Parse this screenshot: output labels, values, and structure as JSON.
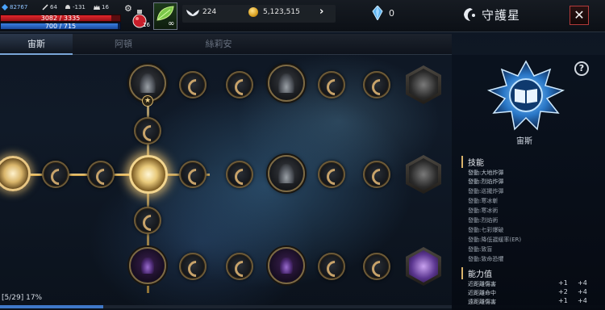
{
  "status": {
    "level_text": "82767",
    "attack": "64",
    "defense": "-131",
    "stat3": "16",
    "hp_text": "3082 / 3335",
    "hp_fraction": 0.924,
    "mp_text": "700 / 715",
    "mp_fraction": 0.979,
    "potion_count": "16",
    "item_infinite": "∞"
  },
  "currency": {
    "wings": "224",
    "gold": "5,123,515",
    "crystal": "0"
  },
  "window": {
    "title": "守護星",
    "close_label": "✕"
  },
  "tabs": [
    {
      "label": "宙斯",
      "active": true
    },
    {
      "label": "阿頓",
      "active": false
    },
    {
      "label": "絲莉安",
      "active": false
    }
  ],
  "progress": {
    "text": "[5/29] 17%",
    "fraction": 0.17
  },
  "panel": {
    "help": "?",
    "emblem_name": "宙斯",
    "skills_header": "技能",
    "skills": [
      "發動:大地炸彈",
      "發動:烈焰炸彈",
      "發動:巡擺炸彈",
      "發動:寒冰斬",
      "發動:寒冰術",
      "發動:烈焰術",
      "發動:七彩爆破",
      "發動:降低遲緩率(ER)",
      "發動:致盲",
      "發動:致命恐懼"
    ],
    "stats_header": "能力值",
    "stats": [
      {
        "name": "近距離傷害",
        "v1": "+1",
        "v2": "+4"
      },
      {
        "name": "近距離命中",
        "v1": "+2",
        "v2": "+4"
      },
      {
        "name": "遠距離傷害",
        "v1": "+1",
        "v2": "+4"
      }
    ]
  },
  "colors": {
    "accent_gold": "#f2d58e",
    "hp_red": "#e0262c",
    "mp_blue": "#3a7fe0",
    "close_border": "#b23a3a"
  }
}
